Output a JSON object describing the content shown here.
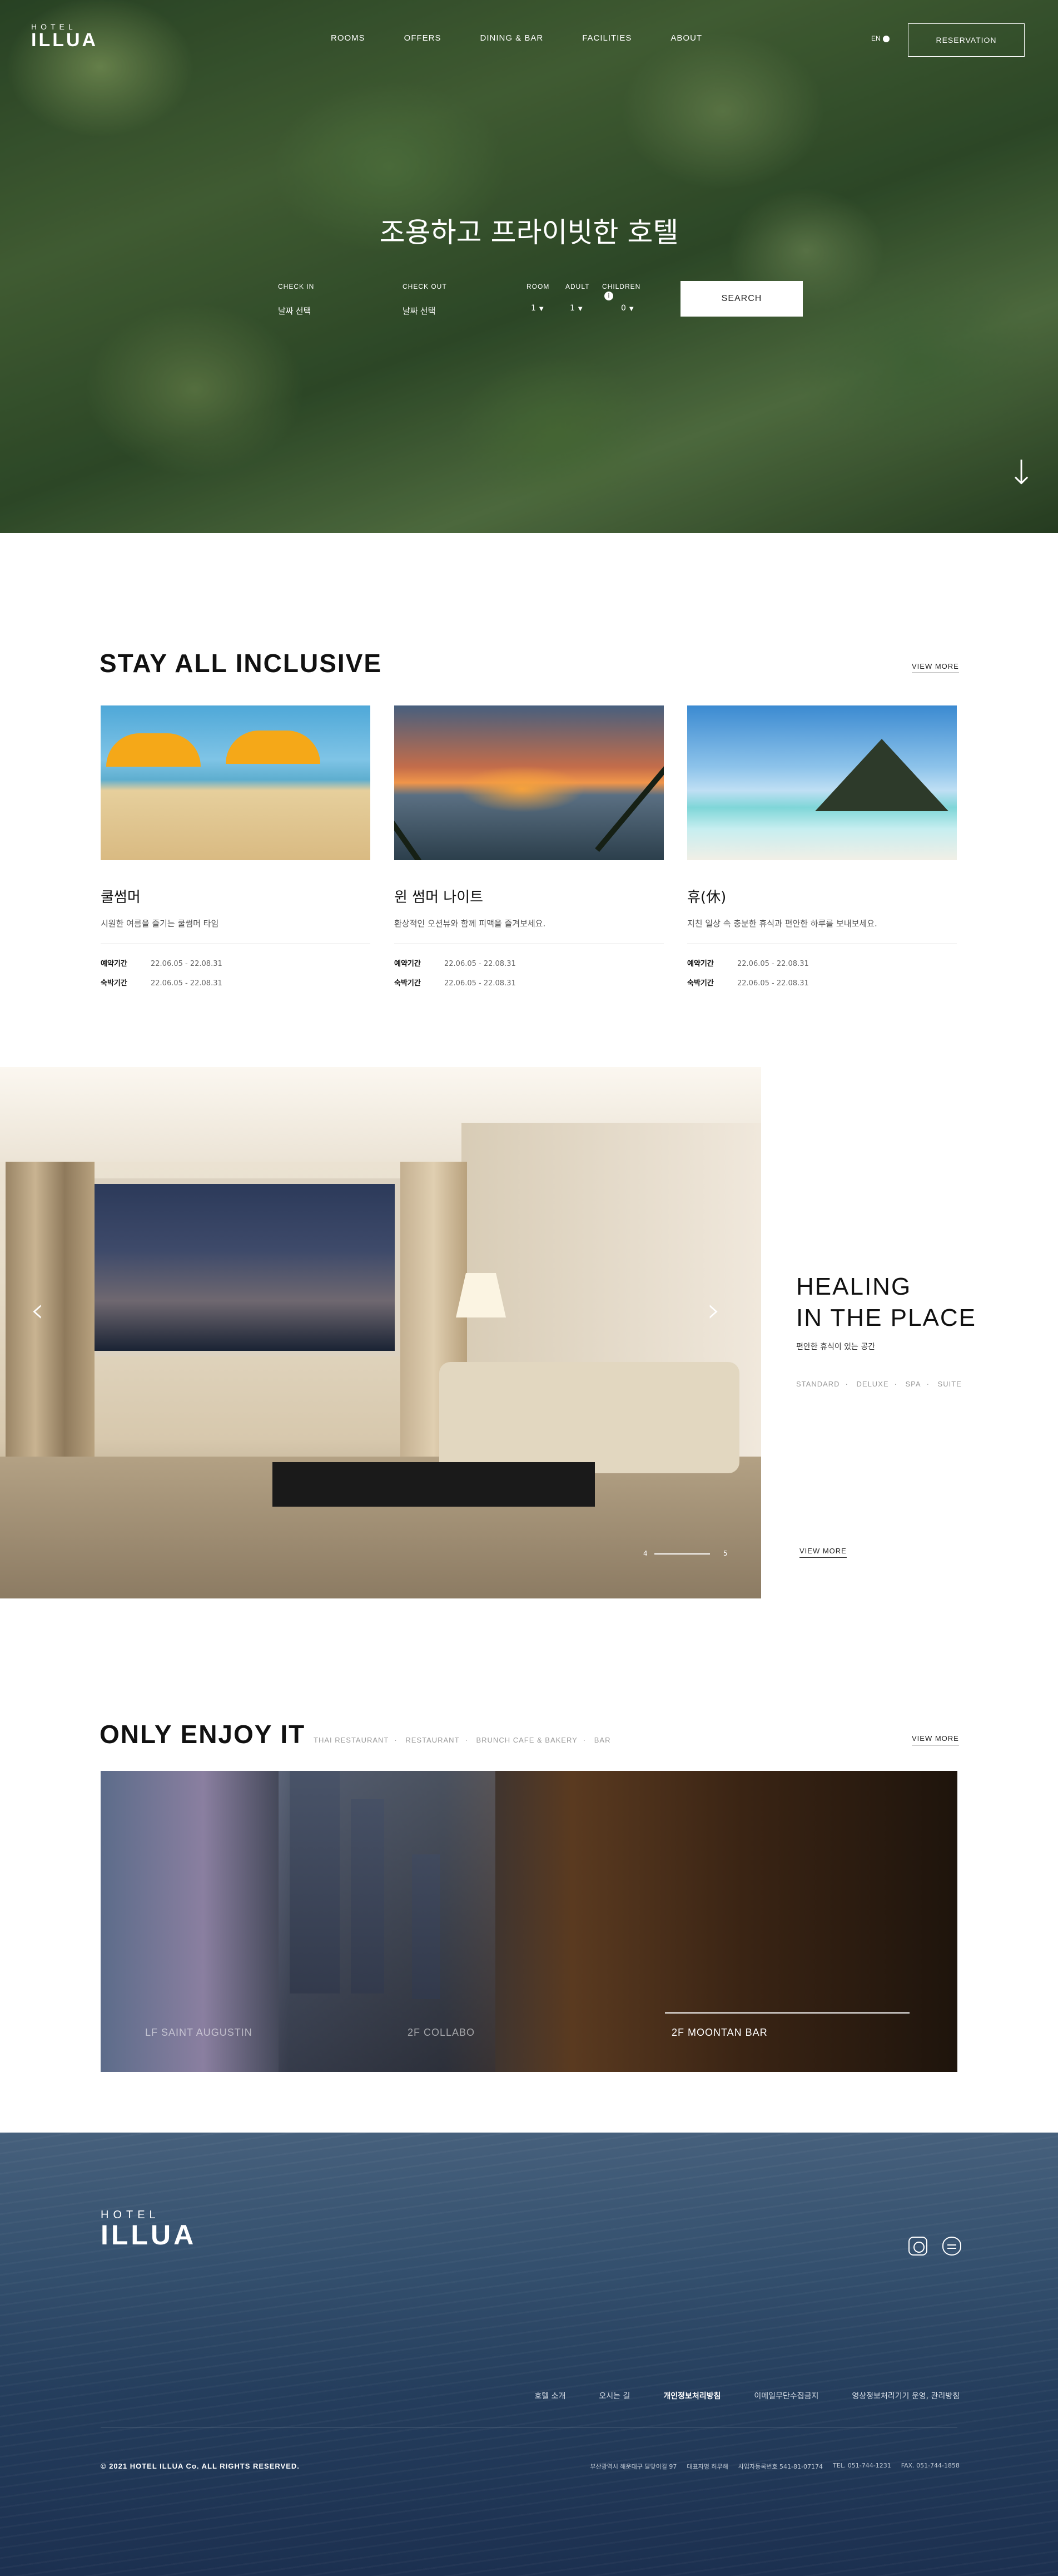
{
  "header": {
    "logo_small": "HOTEL",
    "logo_big": "ILLUA",
    "nav": [
      "ROOMS",
      "OFFERS",
      "DINING & BAR",
      "FACILITIES",
      "ABOUT"
    ],
    "lang": "EN",
    "reservation": "RESERVATION"
  },
  "hero": {
    "title": "조용하고 프라이빗한 호텔",
    "check_in_label": "CHECK IN",
    "check_in_value": "날짜 선택",
    "check_out_label": "CHECK OUT",
    "check_out_value": "날짜 선택",
    "room_label": "ROOM",
    "adult_label": "ADULT",
    "children_label": "CHILDREN",
    "children_info": "i",
    "room_value": "1",
    "adult_value": "1",
    "children_value": "0",
    "search": "SEARCH",
    "scroll_icon": "arrow-down-icon"
  },
  "stay": {
    "title": "STAY ALL INCLUSIVE",
    "view_more": "VIEW MORE",
    "cards": [
      {
        "name": "쿨썸머",
        "desc": "시원한 여름을 즐기는 쿨썸머 타임",
        "label1": "예약기간",
        "date1": "22.06.05 - 22.08.31",
        "label2": "숙박기간",
        "date2": "22.06.05 - 22.08.31"
      },
      {
        "name": "윈 썸머 나이트",
        "desc": "환상적인 오션뷰와 함께 피맥을 즐겨보세요.",
        "label1": "예약기간",
        "date1": "22.06.05 - 22.08.31",
        "label2": "숙박기간",
        "date2": "22.06.05 - 22.08.31"
      },
      {
        "name": "휴(休)",
        "desc": "지친 일상 속 충분한 휴식과 편안한 하루를 보내보세요.",
        "label1": "예약기간",
        "date1": "22.06.05 - 22.08.31",
        "label2": "숙박기간",
        "date2": "22.06.05 - 22.08.31"
      }
    ]
  },
  "healing": {
    "title_line1": "HEALING",
    "title_line2": "IN THE PLACE",
    "subtitle": "편안한 휴식이 있는 공간",
    "types": [
      "STANDARD",
      "DELUXE",
      "SPA",
      "SUITE"
    ],
    "view_more": "VIEW MORE",
    "slide_current": "4",
    "slide_total": "5",
    "slide_progress": 1.0
  },
  "enjoy": {
    "title": "ONLY ENJOY IT",
    "categories": [
      "THAI RESTAURANT",
      "RESTAURANT",
      "BRUNCH CAFE & BAKERY",
      "BAR"
    ],
    "view_more": "VIEW MORE",
    "captions": [
      "LF SAINT AUGUSTIN",
      "2F COLLABO",
      "2F MOONTAN BAR"
    ]
  },
  "footer": {
    "logo_small": "HOTEL",
    "logo_big": "ILLUA",
    "sns": [
      "instagram-icon",
      "kakaotalk-icon"
    ],
    "links": [
      "호텔 소개",
      "오시는 길",
      "개인정보처리방침",
      "이메일무단수집금지",
      "영상정보처리기기 운영, 관리방침"
    ],
    "copyright": "© 2021 HOTEL ILLUA Co. ALL RIGHTS RESERVED.",
    "address": "부산광역시 해운대구 달맞이길 97",
    "ceo": "대표자명 허무해",
    "biz_no": "사업자등록번호 541-81-07174",
    "tel": "TEL. 051-744-1231",
    "fax": "FAX. 051-744-1858"
  }
}
